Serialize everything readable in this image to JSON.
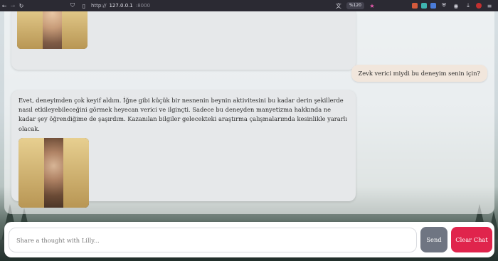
{
  "browser": {
    "url_scheme": "http://",
    "url_host": "127.0.0.1",
    "url_port": ":8000",
    "zoom": "%120"
  },
  "chat": {
    "user_message": "Zevk verici miydi bu deneyim senin için?",
    "bot_message": "Evet, deneyimden çok keyif aldım. İğne gibi küçük bir nesnenin beynin aktivitesini bu kadar derin şekillerde nasıl etkileyebileceğini görmek heyecan verici ve ilginçti. Sadece bu deneyden manyetizma hakkında ne kadar şey öğrendiğime de şaşırdım. Kazanılan bilgiler gelecekteki araştırma çalışmalarımda kesinlikle yararlı olacak."
  },
  "input": {
    "placeholder": "Share a thought with Lilly...",
    "value": ""
  },
  "buttons": {
    "send": "Send",
    "clear": "Clear Chat"
  },
  "colors": {
    "send_bg": "#6f7582",
    "clear_bg": "#e0244c",
    "user_bubble": "#f1e6dc",
    "bot_bubble": "#e6e8ea"
  }
}
